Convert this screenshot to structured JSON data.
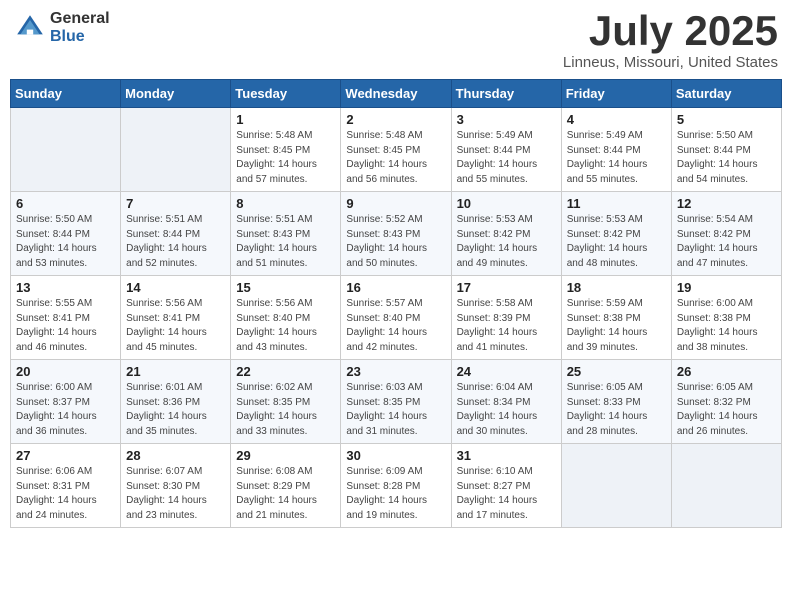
{
  "logo": {
    "general": "General",
    "blue": "Blue"
  },
  "title": "July 2025",
  "location": "Linneus, Missouri, United States",
  "weekdays": [
    "Sunday",
    "Monday",
    "Tuesday",
    "Wednesday",
    "Thursday",
    "Friday",
    "Saturday"
  ],
  "weeks": [
    [
      {
        "day": "",
        "sunrise": "",
        "sunset": "",
        "daylight": ""
      },
      {
        "day": "",
        "sunrise": "",
        "sunset": "",
        "daylight": ""
      },
      {
        "day": "1",
        "sunrise": "Sunrise: 5:48 AM",
        "sunset": "Sunset: 8:45 PM",
        "daylight": "Daylight: 14 hours and 57 minutes."
      },
      {
        "day": "2",
        "sunrise": "Sunrise: 5:48 AM",
        "sunset": "Sunset: 8:45 PM",
        "daylight": "Daylight: 14 hours and 56 minutes."
      },
      {
        "day": "3",
        "sunrise": "Sunrise: 5:49 AM",
        "sunset": "Sunset: 8:44 PM",
        "daylight": "Daylight: 14 hours and 55 minutes."
      },
      {
        "day": "4",
        "sunrise": "Sunrise: 5:49 AM",
        "sunset": "Sunset: 8:44 PM",
        "daylight": "Daylight: 14 hours and 55 minutes."
      },
      {
        "day": "5",
        "sunrise": "Sunrise: 5:50 AM",
        "sunset": "Sunset: 8:44 PM",
        "daylight": "Daylight: 14 hours and 54 minutes."
      }
    ],
    [
      {
        "day": "6",
        "sunrise": "Sunrise: 5:50 AM",
        "sunset": "Sunset: 8:44 PM",
        "daylight": "Daylight: 14 hours and 53 minutes."
      },
      {
        "day": "7",
        "sunrise": "Sunrise: 5:51 AM",
        "sunset": "Sunset: 8:44 PM",
        "daylight": "Daylight: 14 hours and 52 minutes."
      },
      {
        "day": "8",
        "sunrise": "Sunrise: 5:51 AM",
        "sunset": "Sunset: 8:43 PM",
        "daylight": "Daylight: 14 hours and 51 minutes."
      },
      {
        "day": "9",
        "sunrise": "Sunrise: 5:52 AM",
        "sunset": "Sunset: 8:43 PM",
        "daylight": "Daylight: 14 hours and 50 minutes."
      },
      {
        "day": "10",
        "sunrise": "Sunrise: 5:53 AM",
        "sunset": "Sunset: 8:42 PM",
        "daylight": "Daylight: 14 hours and 49 minutes."
      },
      {
        "day": "11",
        "sunrise": "Sunrise: 5:53 AM",
        "sunset": "Sunset: 8:42 PM",
        "daylight": "Daylight: 14 hours and 48 minutes."
      },
      {
        "day": "12",
        "sunrise": "Sunrise: 5:54 AM",
        "sunset": "Sunset: 8:42 PM",
        "daylight": "Daylight: 14 hours and 47 minutes."
      }
    ],
    [
      {
        "day": "13",
        "sunrise": "Sunrise: 5:55 AM",
        "sunset": "Sunset: 8:41 PM",
        "daylight": "Daylight: 14 hours and 46 minutes."
      },
      {
        "day": "14",
        "sunrise": "Sunrise: 5:56 AM",
        "sunset": "Sunset: 8:41 PM",
        "daylight": "Daylight: 14 hours and 45 minutes."
      },
      {
        "day": "15",
        "sunrise": "Sunrise: 5:56 AM",
        "sunset": "Sunset: 8:40 PM",
        "daylight": "Daylight: 14 hours and 43 minutes."
      },
      {
        "day": "16",
        "sunrise": "Sunrise: 5:57 AM",
        "sunset": "Sunset: 8:40 PM",
        "daylight": "Daylight: 14 hours and 42 minutes."
      },
      {
        "day": "17",
        "sunrise": "Sunrise: 5:58 AM",
        "sunset": "Sunset: 8:39 PM",
        "daylight": "Daylight: 14 hours and 41 minutes."
      },
      {
        "day": "18",
        "sunrise": "Sunrise: 5:59 AM",
        "sunset": "Sunset: 8:38 PM",
        "daylight": "Daylight: 14 hours and 39 minutes."
      },
      {
        "day": "19",
        "sunrise": "Sunrise: 6:00 AM",
        "sunset": "Sunset: 8:38 PM",
        "daylight": "Daylight: 14 hours and 38 minutes."
      }
    ],
    [
      {
        "day": "20",
        "sunrise": "Sunrise: 6:00 AM",
        "sunset": "Sunset: 8:37 PM",
        "daylight": "Daylight: 14 hours and 36 minutes."
      },
      {
        "day": "21",
        "sunrise": "Sunrise: 6:01 AM",
        "sunset": "Sunset: 8:36 PM",
        "daylight": "Daylight: 14 hours and 35 minutes."
      },
      {
        "day": "22",
        "sunrise": "Sunrise: 6:02 AM",
        "sunset": "Sunset: 8:35 PM",
        "daylight": "Daylight: 14 hours and 33 minutes."
      },
      {
        "day": "23",
        "sunrise": "Sunrise: 6:03 AM",
        "sunset": "Sunset: 8:35 PM",
        "daylight": "Daylight: 14 hours and 31 minutes."
      },
      {
        "day": "24",
        "sunrise": "Sunrise: 6:04 AM",
        "sunset": "Sunset: 8:34 PM",
        "daylight": "Daylight: 14 hours and 30 minutes."
      },
      {
        "day": "25",
        "sunrise": "Sunrise: 6:05 AM",
        "sunset": "Sunset: 8:33 PM",
        "daylight": "Daylight: 14 hours and 28 minutes."
      },
      {
        "day": "26",
        "sunrise": "Sunrise: 6:05 AM",
        "sunset": "Sunset: 8:32 PM",
        "daylight": "Daylight: 14 hours and 26 minutes."
      }
    ],
    [
      {
        "day": "27",
        "sunrise": "Sunrise: 6:06 AM",
        "sunset": "Sunset: 8:31 PM",
        "daylight": "Daylight: 14 hours and 24 minutes."
      },
      {
        "day": "28",
        "sunrise": "Sunrise: 6:07 AM",
        "sunset": "Sunset: 8:30 PM",
        "daylight": "Daylight: 14 hours and 23 minutes."
      },
      {
        "day": "29",
        "sunrise": "Sunrise: 6:08 AM",
        "sunset": "Sunset: 8:29 PM",
        "daylight": "Daylight: 14 hours and 21 minutes."
      },
      {
        "day": "30",
        "sunrise": "Sunrise: 6:09 AM",
        "sunset": "Sunset: 8:28 PM",
        "daylight": "Daylight: 14 hours and 19 minutes."
      },
      {
        "day": "31",
        "sunrise": "Sunrise: 6:10 AM",
        "sunset": "Sunset: 8:27 PM",
        "daylight": "Daylight: 14 hours and 17 minutes."
      },
      {
        "day": "",
        "sunrise": "",
        "sunset": "",
        "daylight": ""
      },
      {
        "day": "",
        "sunrise": "",
        "sunset": "",
        "daylight": ""
      }
    ]
  ]
}
